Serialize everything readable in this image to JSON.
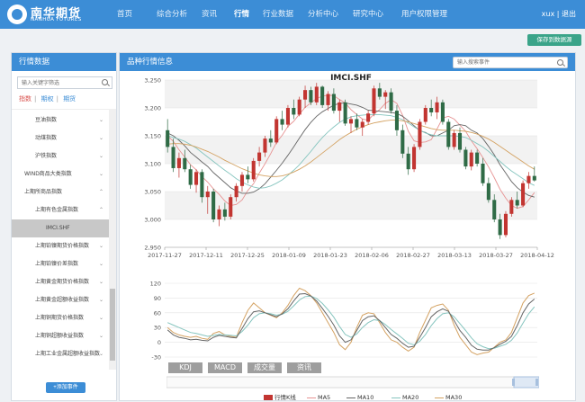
{
  "header": {
    "logo_cn": "南华期货",
    "logo_en": "NANHUA FUTURES",
    "nav": [
      "首页",
      "综合分析",
      "资讯",
      "行情",
      "行业数据",
      "分析中心",
      "研究中心",
      "用户权限管理"
    ],
    "active_nav": "行情",
    "user": "xux",
    "separator": "|",
    "logout": "退出"
  },
  "save_button": "保存到数据源",
  "sidebar": {
    "title": "行情数据",
    "search_placeholder": "输入关键字筛选",
    "tabs": [
      "指数",
      "期权",
      "期货"
    ],
    "items": [
      {
        "label": "豆油指数",
        "indent": 2,
        "chevron": "⌄"
      },
      {
        "label": "动煤指数",
        "indent": 2,
        "chevron": "⌄"
      },
      {
        "label": "沪铁指数",
        "indent": 2,
        "chevron": "⌄"
      },
      {
        "label": "WIND商品大类指数",
        "indent": 1,
        "chevron": "⌄"
      },
      {
        "label": "上期所商品指数",
        "indent": 1,
        "chevron": "⌃"
      },
      {
        "label": "上期有色金属指数",
        "indent": 2,
        "chevron": "⌃"
      },
      {
        "label": "IMCI.SHF",
        "indent": 3,
        "chevron": ""
      },
      {
        "label": "上期铂镍期货价格指数",
        "indent": 2,
        "chevron": "⌄"
      },
      {
        "label": "上期铂镍价差指数",
        "indent": 2,
        "chevron": "⌄"
      },
      {
        "label": "上期黄金期货价格指数",
        "indent": 2,
        "chevron": "⌄"
      },
      {
        "label": "上期黄金超额收益指数",
        "indent": 2,
        "chevron": "⌄"
      },
      {
        "label": "上期铜期货价格指数",
        "indent": 2,
        "chevron": "⌄"
      },
      {
        "label": "上期铜超额收益指数",
        "indent": 2,
        "chevron": "⌄"
      },
      {
        "label": "上期工业金属超额收益指数",
        "indent": 2,
        "chevron": "⌄"
      }
    ],
    "add_button": "+添加事件"
  },
  "main": {
    "title": "品种行情信息",
    "search_placeholder": "输入搜索事件"
  },
  "indicator_tabs": [
    "KDJ",
    "MACD",
    "成交量",
    "资讯"
  ],
  "legend": [
    {
      "name": "行情K线",
      "color": "#c23531",
      "kind": "box"
    },
    {
      "name": "MA5",
      "color": "#e79393",
      "kind": "line"
    },
    {
      "name": "MA10",
      "color": "#666666",
      "kind": "line"
    },
    {
      "name": "MA20",
      "color": "#86c5bf",
      "kind": "line"
    },
    {
      "name": "MA30",
      "color": "#d4a262",
      "kind": "line"
    }
  ],
  "colors": {
    "up": "#c23531",
    "down": "#2f6b46",
    "accent": "#3c8dd6",
    "save": "#3aa489"
  },
  "chart_data": [
    {
      "type": "candlestick",
      "title": "IMCI.SHF",
      "ylim": [
        2950,
        3250
      ],
      "y_ticks": [
        "2,950",
        "3,000",
        "3,050",
        "3,100",
        "3,150",
        "3,200",
        "3,250"
      ],
      "x_ticks": [
        "2017-11-27",
        "2017-12-11",
        "2017-12-25",
        "2018-01-09",
        "2018-01-23",
        "2018-02-06",
        "2018-02-27",
        "2018-03-13",
        "2018-03-27",
        "2018-04-12"
      ],
      "grid": true,
      "ohlc": [
        [
          3160,
          3180,
          3120,
          3130
        ],
        [
          3130,
          3145,
          3085,
          3092
        ],
        [
          3092,
          3120,
          3075,
          3110
        ],
        [
          3110,
          3125,
          3085,
          3090
        ],
        [
          3090,
          3098,
          3055,
          3062
        ],
        [
          3062,
          3090,
          3048,
          3085
        ],
        [
          3085,
          3090,
          3030,
          3040
        ],
        [
          3040,
          3060,
          3010,
          3050
        ],
        [
          3050,
          3055,
          2995,
          3000
        ],
        [
          3000,
          3025,
          2988,
          3018
        ],
        [
          3018,
          3030,
          2998,
          3005
        ],
        [
          3005,
          3045,
          3000,
          3040
        ],
        [
          3040,
          3065,
          3032,
          3060
        ],
        [
          3060,
          3085,
          3050,
          3080
        ],
        [
          3080,
          3095,
          3065,
          3072
        ],
        [
          3072,
          3110,
          3068,
          3105
        ],
        [
          3105,
          3130,
          3095,
          3120
        ],
        [
          3120,
          3150,
          3112,
          3145
        ],
        [
          3145,
          3160,
          3130,
          3138
        ],
        [
          3138,
          3185,
          3135,
          3180
        ],
        [
          3180,
          3195,
          3160,
          3170
        ],
        [
          3170,
          3205,
          3165,
          3200
        ],
        [
          3200,
          3215,
          3180,
          3188
        ],
        [
          3188,
          3220,
          3185,
          3215
        ],
        [
          3215,
          3240,
          3200,
          3232
        ],
        [
          3232,
          3238,
          3205,
          3210
        ],
        [
          3210,
          3245,
          3205,
          3238
        ],
        [
          3238,
          3240,
          3200,
          3205
        ],
        [
          3205,
          3230,
          3195,
          3225
        ],
        [
          3225,
          3235,
          3190,
          3195
        ],
        [
          3195,
          3215,
          3175,
          3210
        ],
        [
          3210,
          3215,
          3168,
          3172
        ],
        [
          3172,
          3185,
          3155,
          3180
        ],
        [
          3180,
          3190,
          3160,
          3165
        ],
        [
          3165,
          3180,
          3150,
          3175
        ],
        [
          3175,
          3195,
          3170,
          3190
        ],
        [
          3190,
          3240,
          3185,
          3235
        ],
        [
          3235,
          3245,
          3215,
          3220
        ],
        [
          3220,
          3232,
          3198,
          3228
        ],
        [
          3228,
          3235,
          3190,
          3195
        ],
        [
          3195,
          3205,
          3150,
          3160
        ],
        [
          3160,
          3170,
          3110,
          3118
        ],
        [
          3118,
          3130,
          3080,
          3090
        ],
        [
          3090,
          3135,
          3085,
          3130
        ],
        [
          3130,
          3180,
          3125,
          3175
        ],
        [
          3175,
          3205,
          3170,
          3200
        ],
        [
          3200,
          3215,
          3185,
          3192
        ],
        [
          3192,
          3220,
          3180,
          3210
        ],
        [
          3210,
          3215,
          3170,
          3175
        ],
        [
          3175,
          3180,
          3125,
          3130
        ],
        [
          3130,
          3160,
          3125,
          3155
        ],
        [
          3155,
          3165,
          3120,
          3125
        ],
        [
          3125,
          3130,
          3090,
          3095
        ],
        [
          3095,
          3125,
          3088,
          3120
        ],
        [
          3120,
          3125,
          3095,
          3100
        ],
        [
          3100,
          3110,
          3060,
          3065
        ],
        [
          3065,
          3075,
          3030,
          3035
        ],
        [
          3035,
          3045,
          2995,
          3000
        ],
        [
          3000,
          3010,
          2965,
          2972
        ],
        [
          2972,
          3015,
          2968,
          3010
        ],
        [
          3010,
          3040,
          3005,
          3035
        ],
        [
          3035,
          3050,
          3020,
          3025
        ],
        [
          3025,
          3070,
          3022,
          3065
        ],
        [
          3065,
          3085,
          3055,
          3078
        ],
        [
          3078,
          3095,
          3068,
          3070
        ]
      ],
      "ma_series": [
        {
          "name": "MA5",
          "values": [
            3150,
            3140,
            3125,
            3112,
            3098,
            3089,
            3077,
            3067,
            3055,
            3045,
            3033,
            3025,
            3027,
            3035,
            3052,
            3064,
            3083,
            3100,
            3118,
            3138,
            3151,
            3167,
            3176,
            3189,
            3201,
            3209,
            3217,
            3221,
            3223,
            3222,
            3215,
            3209,
            3197,
            3188,
            3180,
            3178,
            3189,
            3197,
            3208,
            3215,
            3208,
            3187,
            3158,
            3141,
            3138,
            3139,
            3143,
            3162,
            3182,
            3185,
            3180,
            3169,
            3158,
            3141,
            3127,
            3111,
            3094,
            3075,
            3054,
            3038,
            3025,
            3020,
            3023,
            3035,
            3048
          ]
        },
        {
          "name": "MA10",
          "values": [
            3155,
            3150,
            3142,
            3132,
            3120,
            3112,
            3103,
            3095,
            3084,
            3075,
            3066,
            3057,
            3051,
            3047,
            3047,
            3049,
            3055,
            3064,
            3076,
            3088,
            3101,
            3115,
            3130,
            3146,
            3161,
            3174,
            3185,
            3193,
            3199,
            3205,
            3208,
            3209,
            3207,
            3205,
            3201,
            3196,
            3195,
            3194,
            3193,
            3192,
            3190,
            3185,
            3177,
            3168,
            3159,
            3156,
            3150,
            3150,
            3155,
            3160,
            3168,
            3170,
            3168,
            3160,
            3155,
            3145,
            3131,
            3116,
            3098,
            3083,
            3068,
            3057,
            3049,
            3043,
            3040
          ]
        },
        {
          "name": "MA20",
          "values": [
            3150,
            3147,
            3144,
            3140,
            3134,
            3128,
            3120,
            3112,
            3104,
            3096,
            3088,
            3081,
            3073,
            3067,
            3062,
            3058,
            3056,
            3057,
            3060,
            3065,
            3071,
            3079,
            3088,
            3098,
            3110,
            3122,
            3135,
            3147,
            3157,
            3166,
            3174,
            3180,
            3184,
            3186,
            3187,
            3188,
            3188,
            3188,
            3187,
            3186,
            3183,
            3179,
            3173,
            3166,
            3160,
            3155,
            3152,
            3150,
            3150,
            3150,
            3150,
            3149,
            3147,
            3142,
            3136,
            3130,
            3122,
            3113,
            3104,
            3095,
            3087,
            3080,
            3073,
            3066,
            3061
          ]
        },
        {
          "name": "MA30",
          "values": [
            3135,
            3136,
            3136,
            3135,
            3133,
            3130,
            3126,
            3122,
            3117,
            3112,
            3106,
            3101,
            3096,
            3091,
            3087,
            3083,
            3080,
            3078,
            3077,
            3077,
            3078,
            3081,
            3085,
            3090,
            3096,
            3103,
            3111,
            3119,
            3127,
            3135,
            3143,
            3150,
            3156,
            3162,
            3166,
            3170,
            3173,
            3175,
            3177,
            3178,
            3178,
            3177,
            3175,
            3172,
            3169,
            3166,
            3163,
            3161,
            3160,
            3160,
            3160,
            3159,
            3158,
            3156,
            3153,
            3149,
            3144,
            3138,
            3131,
            3124,
            3117,
            3110,
            3103,
            3096,
            3090
          ]
        }
      ]
    },
    {
      "type": "line",
      "ylim": [
        -30,
        120
      ],
      "y_ticks": [
        "-30",
        "0",
        "30",
        "60",
        "90",
        "120"
      ],
      "series": [
        {
          "name": "K",
          "values": [
            30,
            20,
            15,
            12,
            10,
            12,
            8,
            6,
            18,
            22,
            15,
            12,
            10,
            40,
            65,
            80,
            70,
            60,
            55,
            50,
            60,
            75,
            95,
            110,
            105,
            95,
            80,
            60,
            40,
            20,
            -5,
            -15,
            0,
            30,
            55,
            60,
            58,
            40,
            20,
            5,
            0,
            -10,
            -18,
            -10,
            20,
            45,
            70,
            75,
            78,
            65,
            35,
            10,
            -5,
            -20,
            -25,
            -22,
            -20,
            -10,
            0,
            5,
            20,
            50,
            80,
            95,
            100
          ]
        },
        {
          "name": "D",
          "values": [
            40,
            35,
            30,
            25,
            20,
            18,
            15,
            12,
            14,
            16,
            15,
            14,
            13,
            22,
            35,
            50,
            58,
            60,
            58,
            55,
            57,
            63,
            74,
            86,
            93,
            94,
            89,
            79,
            66,
            51,
            32,
            16,
            10,
            17,
            30,
            40,
            46,
            44,
            36,
            26,
            17,
            8,
            -2,
            -5,
            2,
            16,
            34,
            48,
            58,
            60,
            52,
            38,
            24,
            9,
            -3,
            -9,
            -13,
            -12,
            -8,
            -4,
            4,
            19,
            39,
            58,
            72
          ]
        },
        {
          "name": "J",
          "values": [
            25,
            15,
            10,
            8,
            5,
            6,
            4,
            3,
            10,
            14,
            12,
            10,
            9,
            28,
            48,
            62,
            64,
            60,
            56,
            52,
            58,
            68,
            84,
            98,
            99,
            94,
            84,
            69,
            53,
            35,
            13,
            0,
            5,
            24,
            44,
            52,
            54,
            44,
            30,
            16,
            8,
            -2,
            -10,
            -8,
            10,
            30,
            52,
            62,
            68,
            63,
            44,
            24,
            10,
            -6,
            -14,
            -16,
            -16,
            -11,
            -4,
            2,
            12,
            34,
            60,
            78,
            88
          ]
        }
      ]
    }
  ]
}
